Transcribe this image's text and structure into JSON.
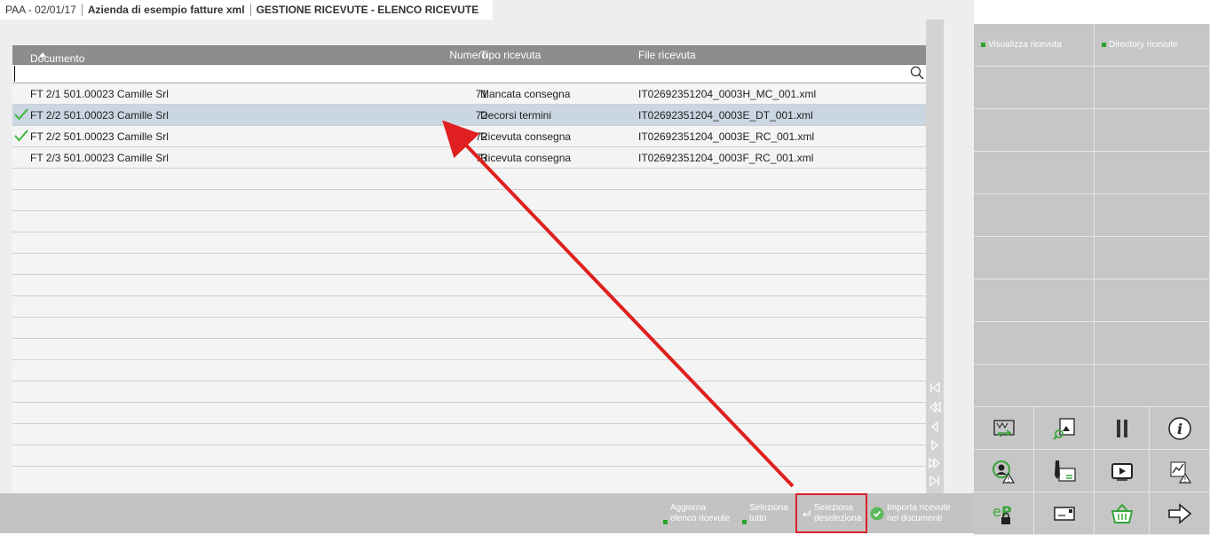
{
  "titlebar": {
    "app": "PAA - 02/01/17",
    "company": "Azienda di esempio fatture xml",
    "screen": "GESTIONE RICEVUTE - ELENCO RICEVUTE"
  },
  "table": {
    "headers": {
      "documento": "Documento",
      "numero": "Numero",
      "tipo": "Tipo ricevuta",
      "file": "File ricevuta"
    },
    "search": {
      "value": "",
      "placeholder": ""
    },
    "rows": [
      {
        "documento": "FT 2/1 501.00023 Camille Srl",
        "numero": "71",
        "tipo": "Mancata consegna",
        "file": "IT02692351204_0003H_MC_001.xml",
        "checked": false,
        "selected": false
      },
      {
        "documento": "FT 2/2 501.00023 Camille Srl",
        "numero": "72",
        "tipo": "Decorsi termini",
        "file": "IT02692351204_0003E_DT_001.xml",
        "checked": true,
        "selected": true
      },
      {
        "documento": "FT 2/2 501.00023 Camille Srl",
        "numero": "72",
        "tipo": "Ricevuta consegna",
        "file": "IT02692351204_0003E_RC_001.xml",
        "checked": true,
        "selected": false
      },
      {
        "documento": "FT 2/3 501.00023 Camille Srl",
        "numero": "73",
        "tipo": "Ricevuta consegna",
        "file": "IT02692351204_0003F_RC_001.xml",
        "checked": false,
        "selected": false
      }
    ]
  },
  "bottombar": {
    "aggiorna": [
      "Aggiorna",
      "elenco ricevute"
    ],
    "seleziona_tutto": [
      "Seleziona",
      "tutto"
    ],
    "seleziona_deseleziona": [
      "Seleziona",
      "deseleziona"
    ],
    "importa": [
      "Importa ricevute",
      "nei documenti"
    ]
  },
  "rightpanel": {
    "visualizza": "Visualizza ricevuta",
    "directory": "Directory ricevute"
  },
  "colors": {
    "accent_green": "#2aa52a",
    "highlight_red": "#d8232a",
    "selected_row": "#cbd6e3",
    "header_bg": "#8d8d8d"
  }
}
